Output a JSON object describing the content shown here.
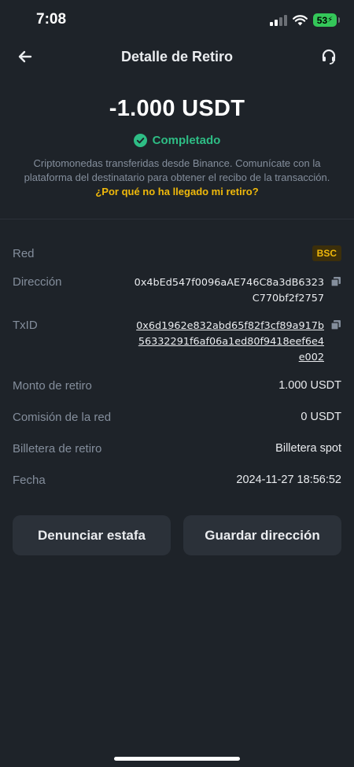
{
  "status_bar": {
    "time": "7:08",
    "battery": "53"
  },
  "nav": {
    "title": "Detalle de Retiro",
    "back_icon": "arrow-left",
    "support_icon": "headset"
  },
  "amount": "-1.000 USDT",
  "status": {
    "text": "Completado",
    "color": "#2ebd85"
  },
  "description": "Criptomonedas transferidas desde Binance. Comunícate con la plataforma del destinatario para obtener el recibo de la transacción.",
  "help_link": "¿Por qué no ha llegado mi retiro?",
  "details": {
    "network": {
      "label": "Red",
      "value": "BSC"
    },
    "address": {
      "label": "Dirección",
      "value": "0x4bEd547f0096aAE746C8a3dB6323C770bf2f2757"
    },
    "txid": {
      "label": "TxID",
      "value": "0x6d1962e832abd65f82f3cf89a917b56332291f6af06a1ed80f9418eef6e4e002"
    },
    "amount": {
      "label": "Monto de retiro",
      "value": "1.000 USDT"
    },
    "fee": {
      "label": "Comisión de la red",
      "value": "0 USDT"
    },
    "wallet": {
      "label": "Billetera de retiro",
      "value": "Billetera spot"
    },
    "date": {
      "label": "Fecha",
      "value": "2024-11-27 18:56:52"
    }
  },
  "buttons": {
    "report": "Denunciar estafa",
    "save": "Guardar dirección"
  },
  "colors": {
    "background": "#1e2329",
    "accent": "#f0b90b",
    "success": "#2ebd85",
    "button": "#2b3139"
  }
}
